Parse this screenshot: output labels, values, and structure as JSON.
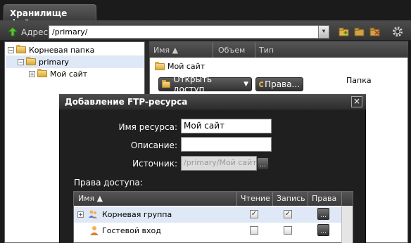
{
  "window": {
    "tab_title": "Хранилище файлов"
  },
  "toolbar": {
    "address_label": "Адрес:",
    "address_value": "/primary/"
  },
  "tree": [
    {
      "label": "Корневая папка",
      "expander": "−"
    },
    {
      "label": "primary",
      "expander": "−"
    },
    {
      "label": "Мой сайт",
      "expander": "+"
    }
  ],
  "list": {
    "columns": {
      "name": "Имя ▲",
      "size": "Объем",
      "type": "Тип"
    },
    "rows": [
      {
        "name": "Мой сайт",
        "type": "Папка"
      }
    ],
    "open_access_button": "Открыть доступ",
    "rights_button": "Права..."
  },
  "dialog": {
    "title": "Добавление FTP-ресурса",
    "close": "×",
    "resource_name_label": "Имя ресурса:",
    "resource_name_value": "Мой сайт",
    "description_label": "Описание:",
    "description_value": "",
    "source_label": "Источник:",
    "source_value": "/primary/Мой сайт/",
    "rights_label": "Права доступа:",
    "grid": {
      "columns": {
        "name": "Имя ▲",
        "read": "Чтение",
        "write": "Запись",
        "rights": "Права"
      },
      "rows": [
        {
          "name": "Корневая группа",
          "read": "✓",
          "write": "✓",
          "expander": "+"
        },
        {
          "name": "Гостевой вход",
          "read": "",
          "write": ""
        }
      ]
    }
  },
  "colors": {
    "accent_green": "#3a9a1a",
    "selected_row": "#dfe8f6",
    "dark_ui": "#2a2a2a"
  }
}
